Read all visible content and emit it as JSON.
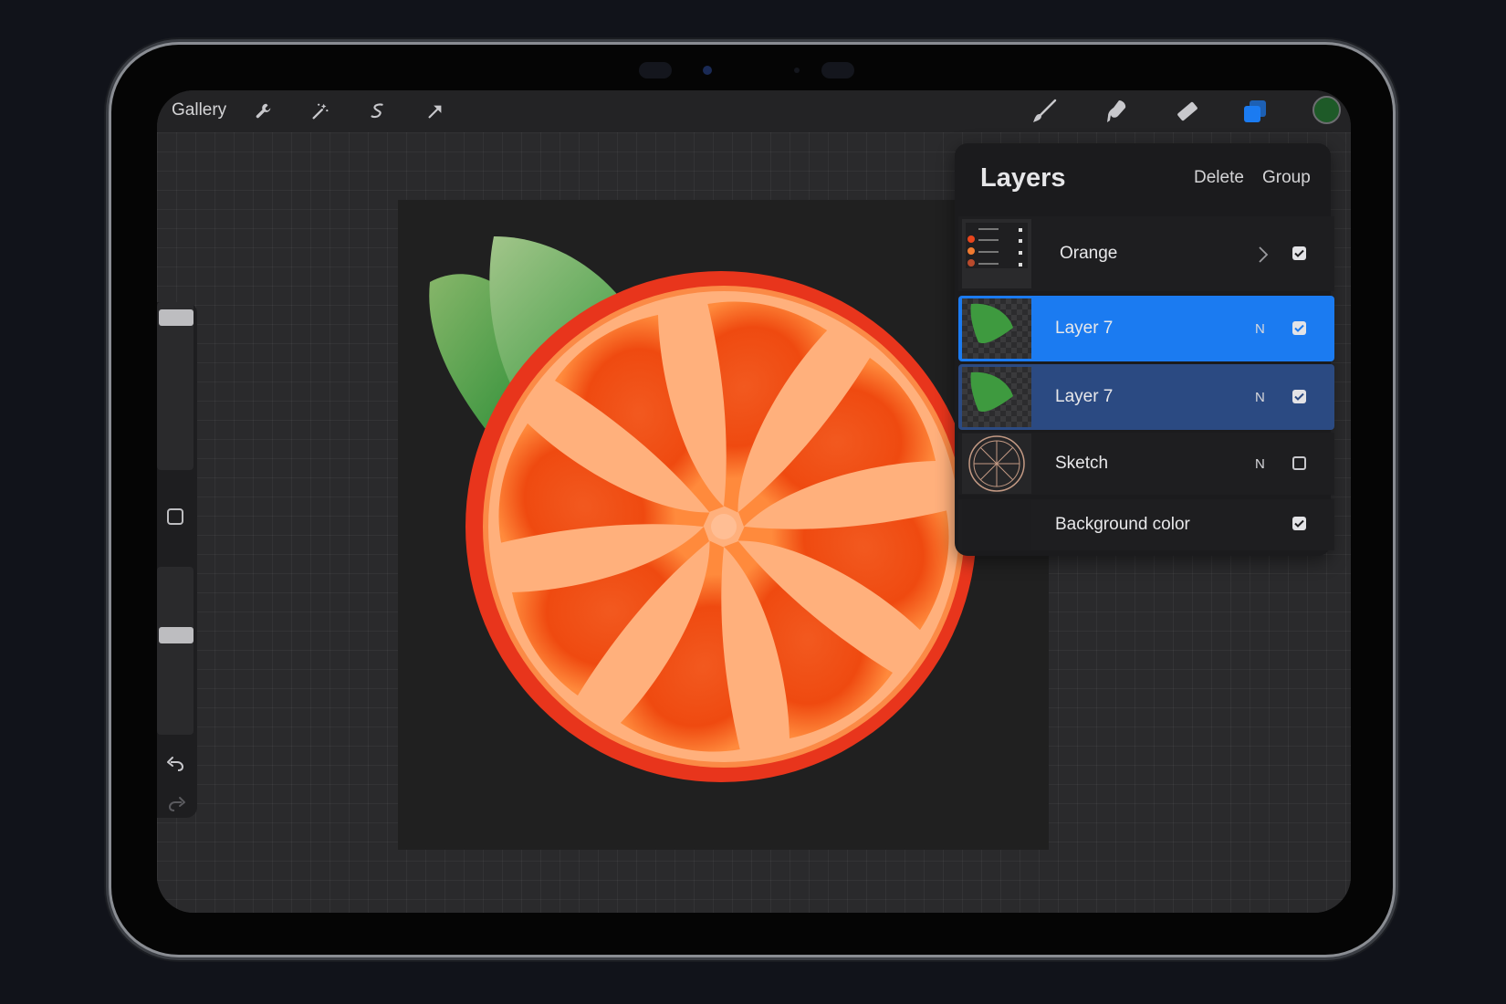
{
  "toolbar": {
    "gallery_label": "Gallery",
    "left_tools": [
      "wrench-icon",
      "magic-wand-icon",
      "selection-icon",
      "transform-arrow-icon"
    ],
    "right_tools": [
      "brush-icon",
      "smudge-icon",
      "eraser-icon",
      "layers-icon"
    ],
    "active_tool": "layers-icon",
    "current_color": "#1e5a28",
    "accent_color": "#1b7bf1"
  },
  "layers_panel": {
    "title": "Layers",
    "delete_label": "Delete",
    "group_label": "Group",
    "layers": [
      {
        "name": "Orange",
        "type": "group",
        "mode": "",
        "visible": true
      },
      {
        "name": "Layer 7",
        "type": "layer",
        "mode": "N",
        "visible": true,
        "state": "selected"
      },
      {
        "name": "Layer 7",
        "type": "layer",
        "mode": "N",
        "visible": true,
        "state": "secondary"
      },
      {
        "name": "Sketch",
        "type": "layer",
        "mode": "N",
        "visible": false
      },
      {
        "name": "Background color",
        "type": "background",
        "mode": "",
        "visible": true
      }
    ]
  },
  "sidebar": {
    "brush_size": 0.95,
    "opacity": 0.6,
    "undo_icon": "undo-icon",
    "redo_icon": "redo-icon"
  }
}
